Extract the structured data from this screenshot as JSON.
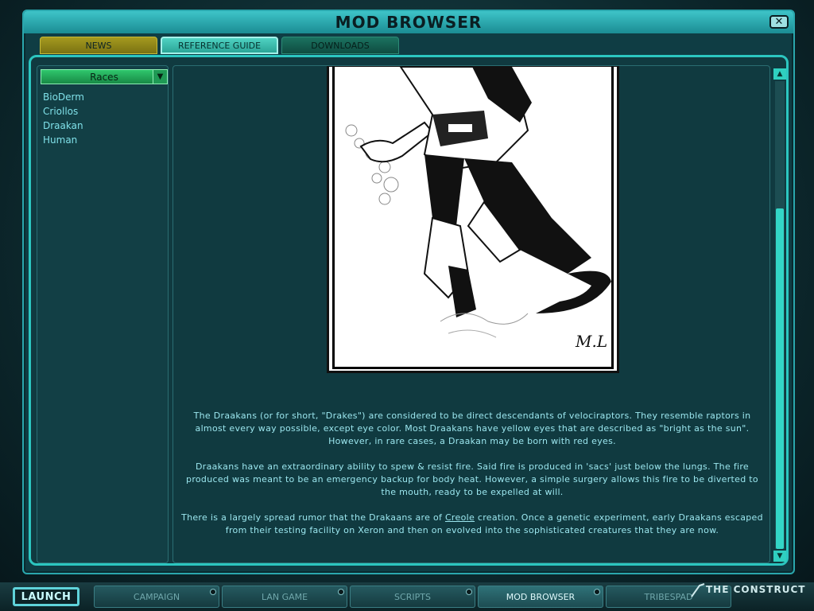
{
  "window": {
    "title": "MOD BROWSER",
    "close_icon": "close-icon"
  },
  "tabs": [
    {
      "label": "NEWS",
      "state": "inactive"
    },
    {
      "label": "REFERENCE GUIDE",
      "state": "active"
    },
    {
      "label": "DOWNLOADS",
      "state": "inactive"
    }
  ],
  "sidebar": {
    "dropdown_value": "Races",
    "items": [
      "BioDerm",
      "Criollos",
      "Draakan",
      "Human"
    ]
  },
  "article": {
    "image_signature": "M.L",
    "paragraphs": [
      "The Draakans (or for short, \"Drakes\") are considered to be direct descendants of velociraptors. They resemble raptors in almost every way possible, except eye color. Most Draakans have yellow eyes that are described as \"bright as the sun\". However, in rare cases, a Draakan may be born with red eyes.",
      "Draakans have an extraordinary ability to spew & resist fire. Said fire is produced in 'sacs' just below the lungs. The fire produced was meant to be an emergency backup for body heat. However, a simple surgery allows this fire to be diverted to the mouth, ready to be expelled at will."
    ],
    "para3_before": "There is a largely spread rumor that the Drakaans are of ",
    "para3_link": "Creole",
    "para3_after": " creation. Once a genetic experiment, early Draakans escaped from their testing facility on Xeron and then on evolved into the sophisticated creatures that they are now."
  },
  "bottom_bar": {
    "launch": "LAUNCH",
    "buttons": [
      "CAMPAIGN",
      "LAN GAME",
      "SCRIPTS",
      "MOD BROWSER",
      "TRIBESPAD"
    ],
    "active": "MOD BROWSER",
    "brand": "THE CONSTRUCT"
  },
  "colors": {
    "accent": "#2cc6c0",
    "text": "#9be6ee",
    "news_tab": "#a59a1f",
    "dropdown": "#2fc66c"
  }
}
